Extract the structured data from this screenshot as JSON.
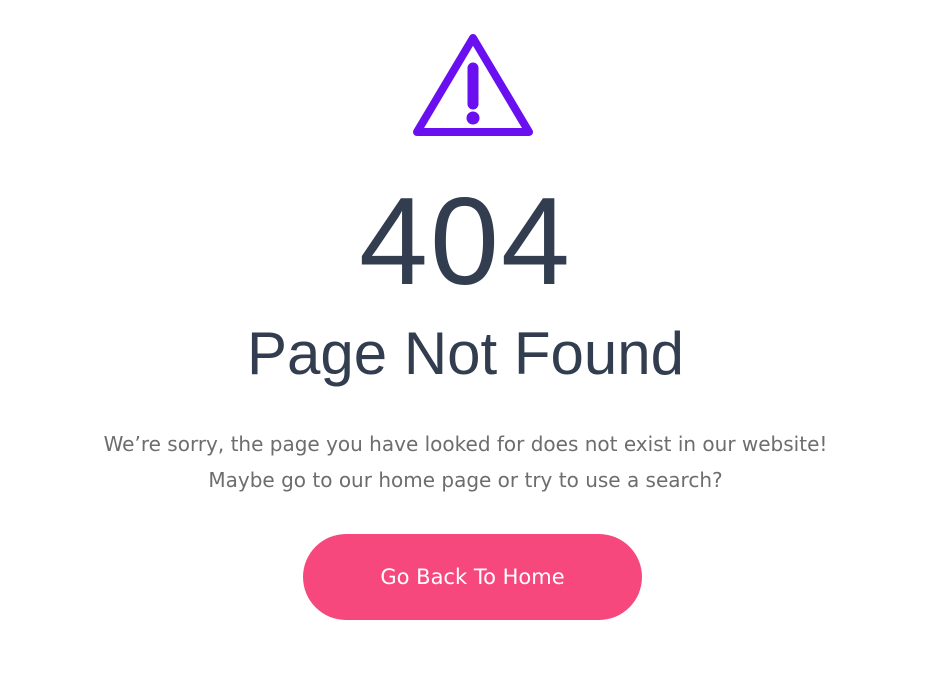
{
  "error": {
    "icon": "warning-triangle-icon",
    "icon_color": "#6a0ff0",
    "code": "404",
    "title": "Page Not Found",
    "message_line1": "We’re sorry, the page you have looked for does not exist in our website!",
    "message_line2": "Maybe go to our home page or try to use a search?",
    "text_color": "#323d4f"
  },
  "button": {
    "label": "Go Back To Home",
    "color": "#f7487e"
  }
}
